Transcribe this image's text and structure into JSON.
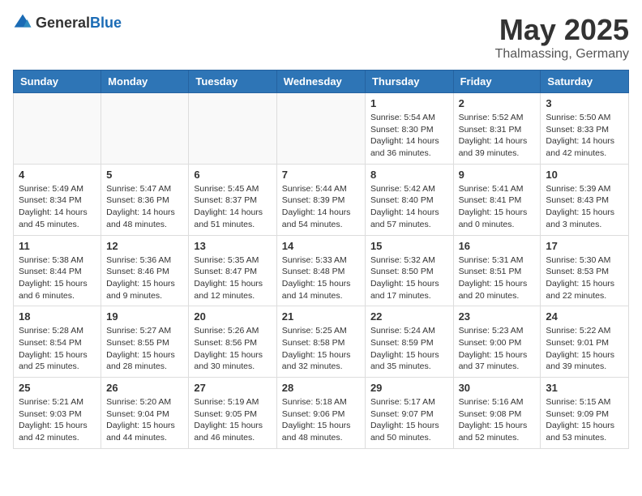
{
  "logo": {
    "text_general": "General",
    "text_blue": "Blue"
  },
  "title": {
    "month_year": "May 2025",
    "location": "Thalmassing, Germany"
  },
  "weekdays": [
    "Sunday",
    "Monday",
    "Tuesday",
    "Wednesday",
    "Thursday",
    "Friday",
    "Saturday"
  ],
  "weeks": [
    [
      {
        "day": "",
        "info": ""
      },
      {
        "day": "",
        "info": ""
      },
      {
        "day": "",
        "info": ""
      },
      {
        "day": "",
        "info": ""
      },
      {
        "day": "1",
        "info": "Sunrise: 5:54 AM\nSunset: 8:30 PM\nDaylight: 14 hours\nand 36 minutes."
      },
      {
        "day": "2",
        "info": "Sunrise: 5:52 AM\nSunset: 8:31 PM\nDaylight: 14 hours\nand 39 minutes."
      },
      {
        "day": "3",
        "info": "Sunrise: 5:50 AM\nSunset: 8:33 PM\nDaylight: 14 hours\nand 42 minutes."
      }
    ],
    [
      {
        "day": "4",
        "info": "Sunrise: 5:49 AM\nSunset: 8:34 PM\nDaylight: 14 hours\nand 45 minutes."
      },
      {
        "day": "5",
        "info": "Sunrise: 5:47 AM\nSunset: 8:36 PM\nDaylight: 14 hours\nand 48 minutes."
      },
      {
        "day": "6",
        "info": "Sunrise: 5:45 AM\nSunset: 8:37 PM\nDaylight: 14 hours\nand 51 minutes."
      },
      {
        "day": "7",
        "info": "Sunrise: 5:44 AM\nSunset: 8:39 PM\nDaylight: 14 hours\nand 54 minutes."
      },
      {
        "day": "8",
        "info": "Sunrise: 5:42 AM\nSunset: 8:40 PM\nDaylight: 14 hours\nand 57 minutes."
      },
      {
        "day": "9",
        "info": "Sunrise: 5:41 AM\nSunset: 8:41 PM\nDaylight: 15 hours\nand 0 minutes."
      },
      {
        "day": "10",
        "info": "Sunrise: 5:39 AM\nSunset: 8:43 PM\nDaylight: 15 hours\nand 3 minutes."
      }
    ],
    [
      {
        "day": "11",
        "info": "Sunrise: 5:38 AM\nSunset: 8:44 PM\nDaylight: 15 hours\nand 6 minutes."
      },
      {
        "day": "12",
        "info": "Sunrise: 5:36 AM\nSunset: 8:46 PM\nDaylight: 15 hours\nand 9 minutes."
      },
      {
        "day": "13",
        "info": "Sunrise: 5:35 AM\nSunset: 8:47 PM\nDaylight: 15 hours\nand 12 minutes."
      },
      {
        "day": "14",
        "info": "Sunrise: 5:33 AM\nSunset: 8:48 PM\nDaylight: 15 hours\nand 14 minutes."
      },
      {
        "day": "15",
        "info": "Sunrise: 5:32 AM\nSunset: 8:50 PM\nDaylight: 15 hours\nand 17 minutes."
      },
      {
        "day": "16",
        "info": "Sunrise: 5:31 AM\nSunset: 8:51 PM\nDaylight: 15 hours\nand 20 minutes."
      },
      {
        "day": "17",
        "info": "Sunrise: 5:30 AM\nSunset: 8:53 PM\nDaylight: 15 hours\nand 22 minutes."
      }
    ],
    [
      {
        "day": "18",
        "info": "Sunrise: 5:28 AM\nSunset: 8:54 PM\nDaylight: 15 hours\nand 25 minutes."
      },
      {
        "day": "19",
        "info": "Sunrise: 5:27 AM\nSunset: 8:55 PM\nDaylight: 15 hours\nand 28 minutes."
      },
      {
        "day": "20",
        "info": "Sunrise: 5:26 AM\nSunset: 8:56 PM\nDaylight: 15 hours\nand 30 minutes."
      },
      {
        "day": "21",
        "info": "Sunrise: 5:25 AM\nSunset: 8:58 PM\nDaylight: 15 hours\nand 32 minutes."
      },
      {
        "day": "22",
        "info": "Sunrise: 5:24 AM\nSunset: 8:59 PM\nDaylight: 15 hours\nand 35 minutes."
      },
      {
        "day": "23",
        "info": "Sunrise: 5:23 AM\nSunset: 9:00 PM\nDaylight: 15 hours\nand 37 minutes."
      },
      {
        "day": "24",
        "info": "Sunrise: 5:22 AM\nSunset: 9:01 PM\nDaylight: 15 hours\nand 39 minutes."
      }
    ],
    [
      {
        "day": "25",
        "info": "Sunrise: 5:21 AM\nSunset: 9:03 PM\nDaylight: 15 hours\nand 42 minutes."
      },
      {
        "day": "26",
        "info": "Sunrise: 5:20 AM\nSunset: 9:04 PM\nDaylight: 15 hours\nand 44 minutes."
      },
      {
        "day": "27",
        "info": "Sunrise: 5:19 AM\nSunset: 9:05 PM\nDaylight: 15 hours\nand 46 minutes."
      },
      {
        "day": "28",
        "info": "Sunrise: 5:18 AM\nSunset: 9:06 PM\nDaylight: 15 hours\nand 48 minutes."
      },
      {
        "day": "29",
        "info": "Sunrise: 5:17 AM\nSunset: 9:07 PM\nDaylight: 15 hours\nand 50 minutes."
      },
      {
        "day": "30",
        "info": "Sunrise: 5:16 AM\nSunset: 9:08 PM\nDaylight: 15 hours\nand 52 minutes."
      },
      {
        "day": "31",
        "info": "Sunrise: 5:15 AM\nSunset: 9:09 PM\nDaylight: 15 hours\nand 53 minutes."
      }
    ]
  ]
}
